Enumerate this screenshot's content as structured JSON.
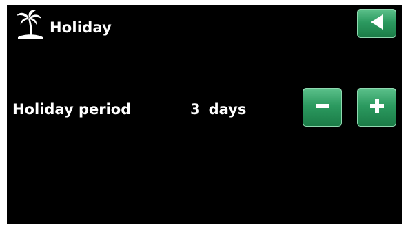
{
  "header": {
    "title": "Holiday",
    "icon": "palm-tree-icon",
    "back_icon": "triangle-left-icon"
  },
  "setting": {
    "label": "Holiday period",
    "value": "3",
    "unit": "days",
    "decrease_icon": "minus-icon",
    "increase_icon": "plus-icon"
  },
  "colors": {
    "background": "#000000",
    "text": "#ffffff",
    "button_green": "#2c9a60"
  }
}
